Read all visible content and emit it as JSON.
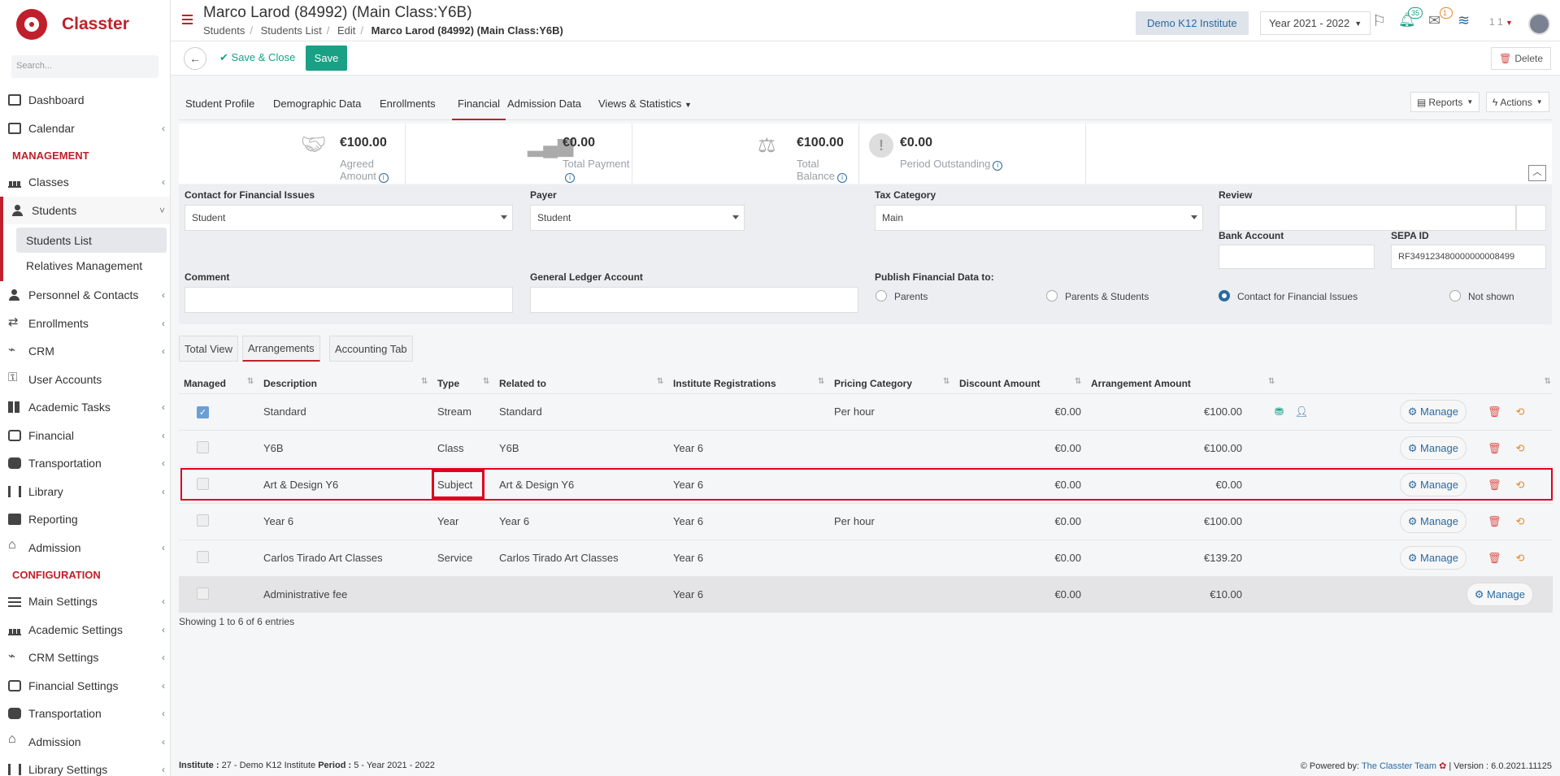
{
  "app": {
    "name": "Classter",
    "search_placeholder": "Search..."
  },
  "sidebar": {
    "items_top": [
      {
        "label": "Dashboard",
        "icon": "monitor-icon"
      },
      {
        "label": "Calendar",
        "icon": "calendar-icon"
      }
    ],
    "section_management": "MANAGEMENT",
    "classes": "Classes",
    "students": "Students",
    "students_list": "Students List",
    "relatives": "Relatives Management",
    "items_mid": [
      {
        "label": "Personnel & Contacts",
        "icon": "contacts-icon"
      },
      {
        "label": "Enrollments",
        "icon": "arrows-icon"
      },
      {
        "label": "CRM",
        "icon": "crm-icon"
      },
      {
        "label": "User Accounts",
        "icon": "key-icon"
      },
      {
        "label": "Academic Tasks",
        "icon": "grid-icon"
      },
      {
        "label": "Financial",
        "icon": "coins-icon"
      },
      {
        "label": "Transportation",
        "icon": "bus-icon"
      },
      {
        "label": "Library",
        "icon": "library-icon"
      },
      {
        "label": "Reporting",
        "icon": "printer-icon"
      },
      {
        "label": "Admission",
        "icon": "bank-icon"
      }
    ],
    "section_configuration": "CONFIGURATION",
    "items_conf": [
      {
        "label": "Main Settings",
        "icon": "sliders-icon"
      },
      {
        "label": "Academic Settings",
        "icon": "bars-icon"
      },
      {
        "label": "CRM Settings",
        "icon": "crm-icon"
      },
      {
        "label": "Financial Settings",
        "icon": "coins-icon"
      },
      {
        "label": "Transportation",
        "icon": "bus-icon"
      },
      {
        "label": "Admission",
        "icon": "bank-icon"
      },
      {
        "label": "Library Settings",
        "icon": "library-icon"
      }
    ]
  },
  "header": {
    "title": "Marco Larod (84992) (Main Class:Y6B)",
    "breadcrumbs": [
      "Students",
      "Students List",
      "Edit"
    ],
    "breadcrumb_current": "Marco Larod (84992) (Main Class:Y6B)",
    "institute": "Demo K12 Institute",
    "year": "Year 2021 - 2022",
    "notif_count": "35",
    "mail_count": "1",
    "user_count": "1 1"
  },
  "toolbar": {
    "back": "←",
    "save_close": "Save & Close",
    "save": "Save",
    "delete": "Delete"
  },
  "tabs": [
    "Student Profile",
    "Demographic Data",
    "Enrollments",
    "Financial",
    "Admission Data",
    "Views & Statistics"
  ],
  "reports": "Reports",
  "actions": "Actions",
  "summary": [
    {
      "amount": "€100.00",
      "label": "Agreed Amount",
      "icon": "handshake-icon"
    },
    {
      "amount": "€0.00",
      "label": "Total Payment",
      "icon": "bar-chart-icon"
    },
    {
      "amount": "€100.00",
      "label": "Total Balance",
      "icon": "scale-icon"
    },
    {
      "amount": "€0.00",
      "label": "Period Outstanding",
      "icon": "exclamation-icon"
    }
  ],
  "form": {
    "contact_label": "Contact for Financial Issues",
    "contact_value": "Student",
    "payer_label": "Payer",
    "payer_value": "Student",
    "tax_label": "Tax Category",
    "tax_value": "Main",
    "review_label": "Review",
    "bank_label": "Bank Account",
    "sepa_label": "SEPA ID",
    "sepa_value": "RF349123480000000008499",
    "comment_label": "Comment",
    "gl_label": "General Ledger Account",
    "publish_label": "Publish Financial Data to:",
    "publish_options": [
      "Parents",
      "Parents & Students",
      "Contact for Financial Issues",
      "Not shown"
    ],
    "publish_selected": "Contact for Financial Issues"
  },
  "subtabs": [
    "Total View",
    "Arrangements",
    "Accounting Tab"
  ],
  "table": {
    "headers": [
      "Managed",
      "Description",
      "Type",
      "Related to",
      "Institute Registrations",
      "Pricing Category",
      "Discount Amount",
      "Arrangement Amount"
    ],
    "rows": [
      {
        "managed": true,
        "description": "Standard",
        "type": "Stream",
        "related": "Standard",
        "registrations": "",
        "pricing": "Per hour",
        "discount": "€0.00",
        "amount": "€100.00"
      },
      {
        "managed": false,
        "description": "Y6B",
        "type": "Class",
        "related": "Y6B",
        "registrations": "Year 6",
        "pricing": "",
        "discount": "€0.00",
        "amount": "€100.00"
      },
      {
        "managed": false,
        "description": "Art & Design Y6",
        "type": "Subject",
        "related": "Art & Design Y6",
        "registrations": "Year 6",
        "pricing": "",
        "discount": "€0.00",
        "amount": "€0.00"
      },
      {
        "managed": false,
        "description": "Year 6",
        "type": "Year",
        "related": "Year 6",
        "registrations": "Year 6",
        "pricing": "Per hour",
        "discount": "€0.00",
        "amount": "€100.00"
      },
      {
        "managed": false,
        "description": "Carlos Tirado Art Classes",
        "type": "Service",
        "related": "Carlos Tirado Art Classes",
        "registrations": "Year 6",
        "pricing": "",
        "discount": "€0.00",
        "amount": "€139.20"
      },
      {
        "managed": false,
        "description": "Administrative fee",
        "type": "",
        "related": "",
        "registrations": "Year 6",
        "pricing": "",
        "discount": "€0.00",
        "amount": "€10.00"
      }
    ],
    "manage_label": "Manage",
    "showing": "Showing 1 to 6 of 6 entries"
  },
  "footer": {
    "institute_label": "Institute :",
    "institute_value": "27 - Demo K12 Institute",
    "period_label": "Period :",
    "period_value": "5 - Year 2021 - 2022",
    "powered": "Powered by:",
    "team": "The Classter Team",
    "version": "| Version : 6.0.2021.11125"
  }
}
